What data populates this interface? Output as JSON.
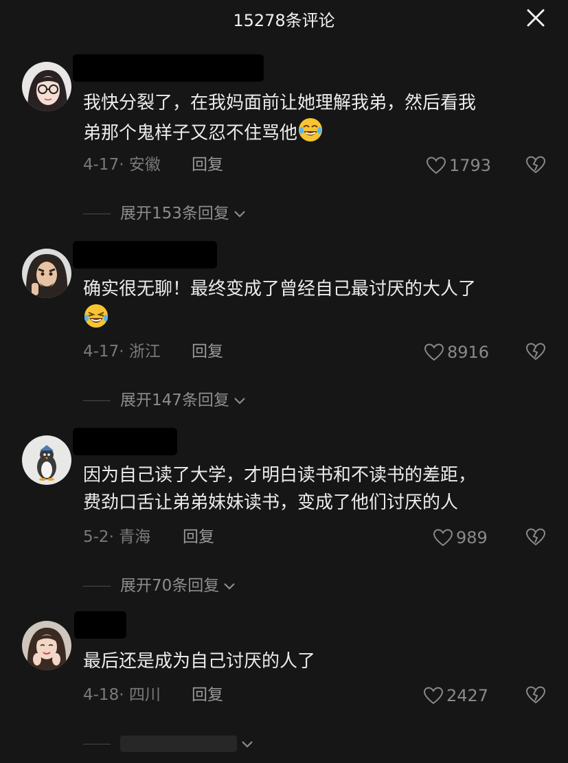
{
  "header": {
    "title": "15278条评论"
  },
  "comments": [
    {
      "text": "我快分裂了，在我妈面前让她理解我弟，然后看我\n弟那个鬼样子又忍不住骂他",
      "emoji": "crying-laughing-face",
      "date_location": "4-17· 安徽",
      "reply_label": "回复",
      "likes": "1793",
      "expand_label": "展开153条回复"
    },
    {
      "text": "确实很无聊！最终变成了曾经自己最讨厌的大人了\n",
      "emoji": "laughing-face",
      "date_location": "4-17· 浙江",
      "reply_label": "回复",
      "likes": "8916",
      "expand_label": "展开147条回复"
    },
    {
      "text": "因为自己读了大学，才明白读书和不读书的差距，\n费劲口舌让弟弟妹妹读书，变成了他们讨厌的人",
      "emoji": "",
      "date_location": "5-2· 青海",
      "reply_label": "回复",
      "likes": "989",
      "expand_label": "展开70条回复"
    },
    {
      "text": "最后还是成为自己讨厌的人了",
      "emoji": "",
      "date_location": "4-18· 四川",
      "reply_label": "回复",
      "likes": "2427",
      "expand_label": ""
    }
  ],
  "colors": {
    "background": "#161616",
    "text": "#ececec",
    "meta": "#7a7a7a"
  }
}
